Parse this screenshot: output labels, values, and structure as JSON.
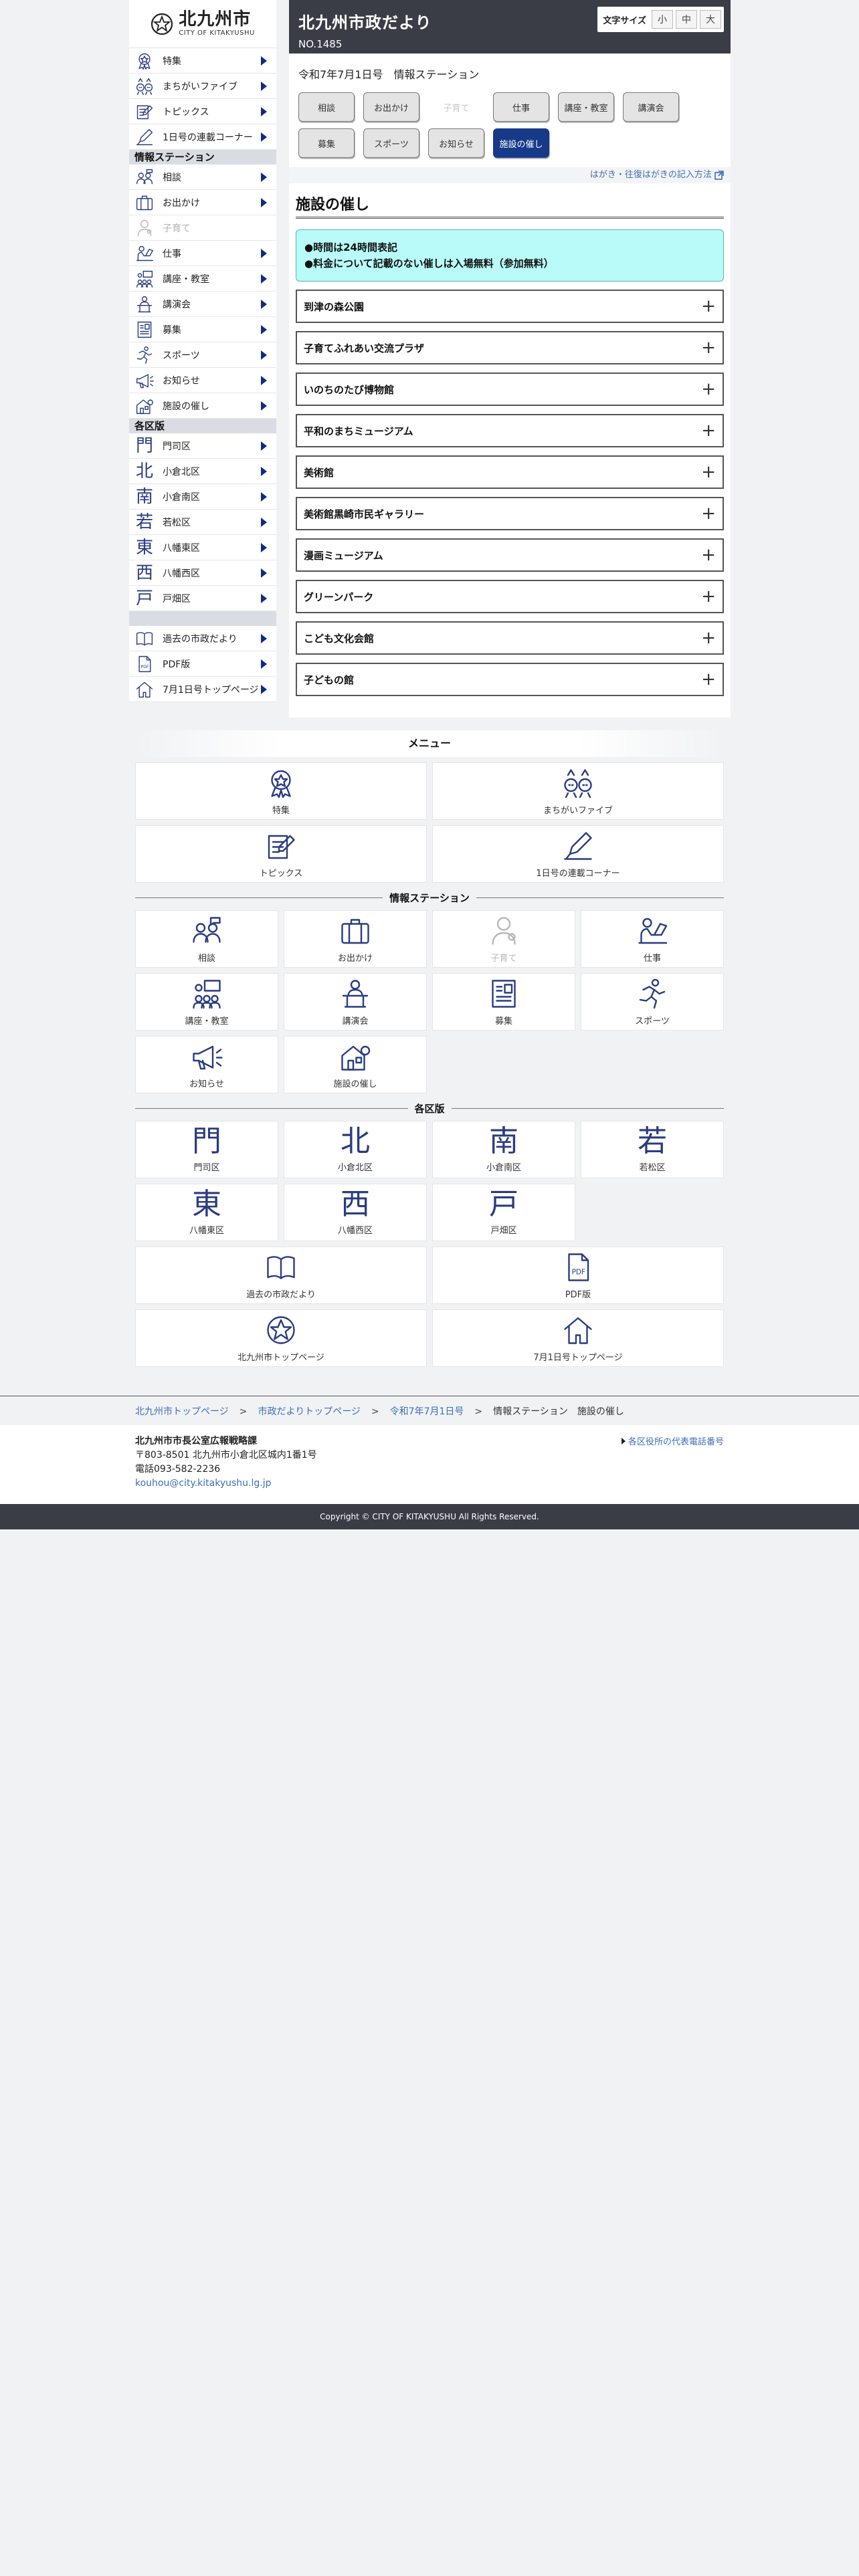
{
  "sidebar": {
    "logo": {
      "main": "北九州市",
      "sub": "CITY OF KITAKYUSHU"
    },
    "top": [
      {
        "label": "特集",
        "icon": "badge-icon"
      },
      {
        "label": "まちがいファイブ",
        "icon": "mascots-icon"
      },
      {
        "label": "トピックス",
        "icon": "notepad-icon"
      },
      {
        "label": "1日号の連載コーナー",
        "icon": "pen-icon"
      }
    ],
    "info_head": "情報ステーション",
    "info": [
      {
        "label": "相談",
        "icon": "consult-icon"
      },
      {
        "label": "お出かけ",
        "icon": "suitcase-icon"
      },
      {
        "label": "子育て",
        "icon": "childcare-icon"
      },
      {
        "label": "仕事",
        "icon": "work-icon"
      },
      {
        "label": "講座・教室",
        "icon": "classroom-icon"
      },
      {
        "label": "講演会",
        "icon": "lecture-icon"
      },
      {
        "label": "募集",
        "icon": "recruit-icon"
      },
      {
        "label": "スポーツ",
        "icon": "sports-icon"
      },
      {
        "label": "お知らせ",
        "icon": "megaphone-icon"
      },
      {
        "label": "施設の催し",
        "icon": "facility-icon"
      }
    ],
    "ward_head": "各区版",
    "wards": [
      {
        "kanji": "門",
        "label": "門司区"
      },
      {
        "kanji": "北",
        "label": "小倉北区"
      },
      {
        "kanji": "南",
        "label": "小倉南区"
      },
      {
        "kanji": "若",
        "label": "若松区"
      },
      {
        "kanji": "東",
        "label": "八幡東区"
      },
      {
        "kanji": "西",
        "label": "八幡西区"
      },
      {
        "kanji": "戸",
        "label": "戸畑区"
      }
    ],
    "bottom": [
      {
        "label": "過去の市政だより",
        "icon": "book-icon"
      },
      {
        "label": "PDF版",
        "icon": "pdf-icon"
      },
      {
        "label": "7月1日号トップページ",
        "icon": "home-icon"
      }
    ]
  },
  "header": {
    "title": "北九州市政だより",
    "number": "NO.1485",
    "font_size": {
      "label": "文字サイズ",
      "small": "小",
      "medium": "中",
      "large": "大"
    }
  },
  "issue": "令和7年7月1日号　情報ステーション",
  "tabs": [
    {
      "label": "相談",
      "state": "normal"
    },
    {
      "label": "お出かけ",
      "state": "normal"
    },
    {
      "label": "子育て",
      "state": "disabled"
    },
    {
      "label": "仕事",
      "state": "normal"
    },
    {
      "label": "講座・教室",
      "state": "normal"
    },
    {
      "label": "講演会",
      "state": "normal"
    },
    {
      "label": "募集",
      "state": "normal"
    },
    {
      "label": "スポーツ",
      "state": "normal"
    },
    {
      "label": "お知らせ",
      "state": "normal"
    },
    {
      "label": "施設の催し",
      "state": "active"
    }
  ],
  "postcard_link": "はがき・往復はがきの記入方法",
  "section": {
    "title": "施設の催し",
    "notices": [
      "●時間は24時間表記",
      "●料金について記載のない催しは入場無料（参加無料）"
    ],
    "facilities": [
      "到津の森公園",
      "子育てふれあい交流プラザ",
      "いのちのたび博物館",
      "平和のまちミュージアム",
      "美術館",
      "美術館黒崎市民ギャラリー",
      "漫画ミュージアム",
      "グリーンパーク",
      "こども文化会館",
      "子どもの館"
    ],
    "expand_symbol": "+"
  },
  "menu": {
    "title": "メニュー",
    "top": [
      {
        "label": "特集",
        "icon": "badge-icon"
      },
      {
        "label": "まちがいファイブ",
        "icon": "mascots-icon"
      },
      {
        "label": "トピックス",
        "icon": "notepad-icon"
      },
      {
        "label": "1日号の連載コーナー",
        "icon": "pen-icon"
      }
    ],
    "info_head": "情報ステーション",
    "ward_head": "各区版",
    "bottom": [
      {
        "label": "過去の市政だより",
        "icon": "book-icon"
      },
      {
        "label": "PDF版",
        "icon": "pdf-icon"
      },
      {
        "label": "北九州市トップページ",
        "icon": "city-emblem-icon"
      },
      {
        "label": "7月1日号トップページ",
        "icon": "home-icon"
      }
    ]
  },
  "breadcrumb": [
    {
      "label": "北九州市トップページ",
      "link": true
    },
    {
      "label": "市政だよりトップページ",
      "link": true
    },
    {
      "label": "令和7年7月1日号",
      "link": true
    },
    {
      "label": "情報ステーション　施設の催し",
      "link": false
    }
  ],
  "footer": {
    "org": "北九州市市長公室広報戦略課",
    "address": "〒803-8501 北九州市小倉北区城内1番1号",
    "phone": "電話093-582-2236",
    "email": "kouhou@city.kitakyushu.lg.jp",
    "rep_link": "各区役所の代表電話番号",
    "copyright": "Copyright © CITY OF KITAKYUSHU All Rights Reserved."
  },
  "colors": {
    "navy": "#173a88",
    "header_bg": "#3a3d45",
    "notice_bg": "#b8fbf8",
    "link": "#3c6fb9",
    "icon": "#2a3c80"
  }
}
